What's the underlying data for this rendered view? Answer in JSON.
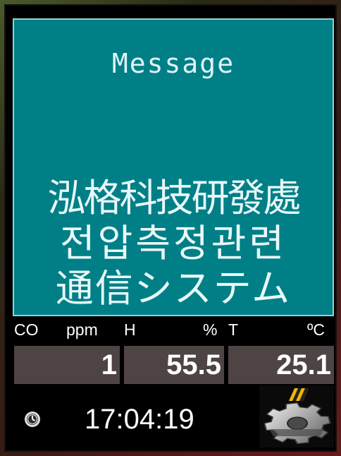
{
  "message": {
    "title": "Message",
    "line1": "泓格科技研發處",
    "line2": "전압측정관련",
    "line3": "通信システム"
  },
  "sensors": {
    "co": {
      "label": "CO",
      "unit": "ppm",
      "value": "1"
    },
    "humidity": {
      "label": "H",
      "unit": "%",
      "value": "55.5"
    },
    "temperature": {
      "label": "T",
      "unit": "ºC",
      "value": "25.1"
    }
  },
  "clock": {
    "time": "17:04:19",
    "icon": "clock-icon"
  },
  "settings": {
    "icon": "gear-icon"
  },
  "colors": {
    "panel": "#007f87",
    "panel_border": "#8fd3d6",
    "value_box": "#4f4444",
    "background": "#000000"
  }
}
